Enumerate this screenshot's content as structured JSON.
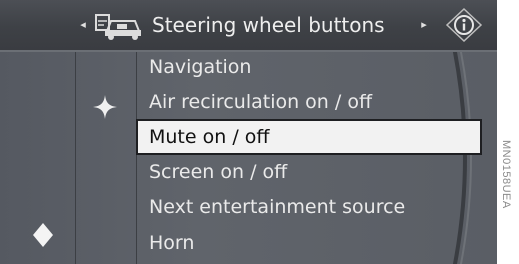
{
  "header": {
    "title": "Steering wheel buttons",
    "left_arrow": "◂",
    "right_arrow": "▸",
    "left_icon": "car-settings-icon",
    "right_icon": "info-icon"
  },
  "menu": {
    "items": [
      {
        "label": "Navigation"
      },
      {
        "label": "Air recirculation on / off"
      },
      {
        "label": "Mute on / off"
      },
      {
        "label": "Screen on / off"
      },
      {
        "label": "Next entertainment source"
      },
      {
        "label": "Horn"
      }
    ],
    "selected_label": "Mute on / off"
  },
  "markers": {
    "sparkle_icon": "sparkle-icon",
    "diamond_icon": "diamond-icon"
  },
  "watermark": "MN0158UEA"
}
